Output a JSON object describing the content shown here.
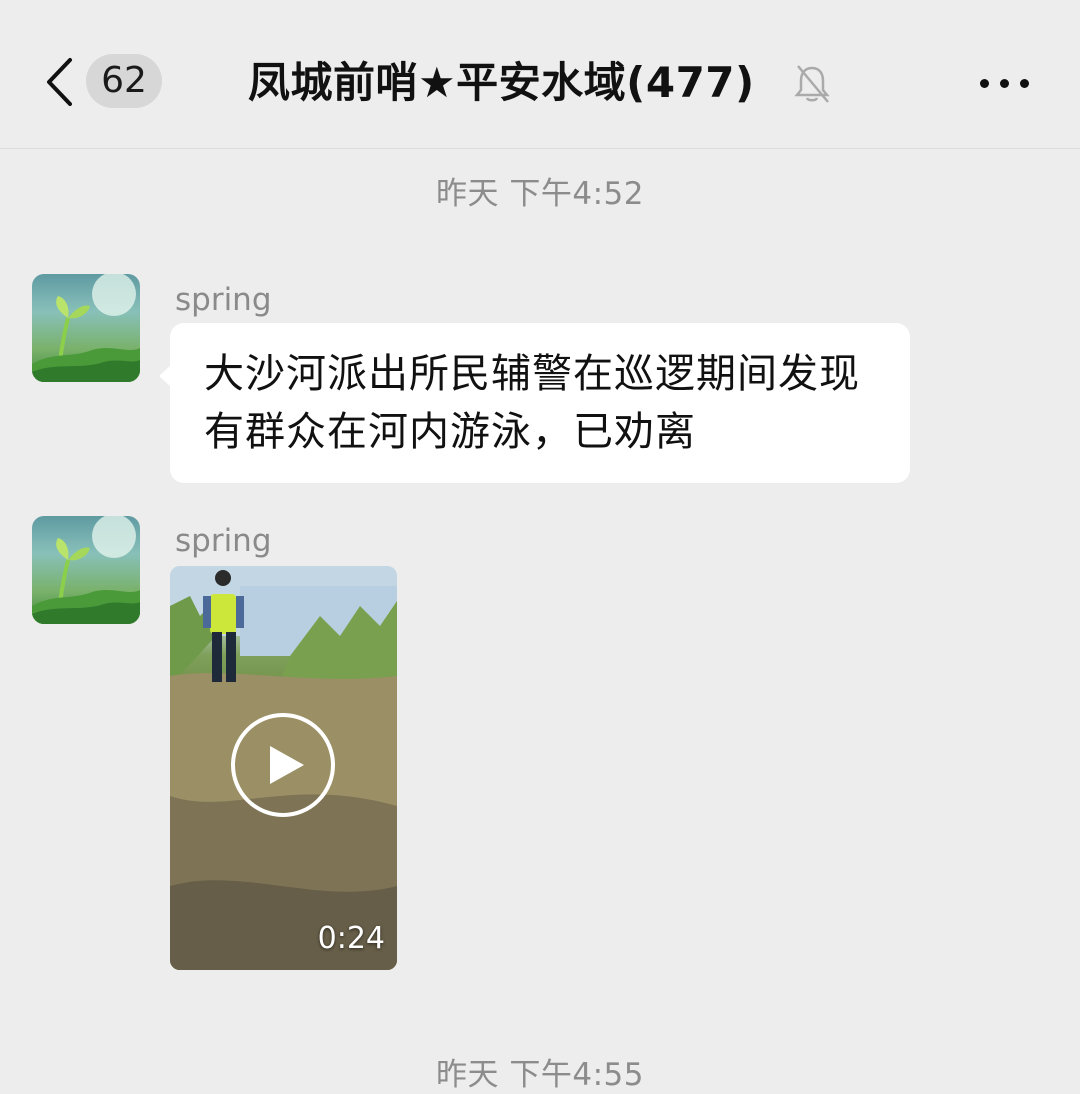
{
  "header": {
    "unread_count": "62",
    "title": "凤城前哨★平安水域(477)",
    "icons": {
      "back": "chevron-left-icon",
      "mute": "bell-off-icon",
      "more": "more-dots-icon"
    }
  },
  "messages": [
    {
      "time": "昨天 下午4:52"
    },
    {
      "sender": "spring",
      "type": "text",
      "text": "大沙河派出所民辅警在巡逻期间发现有群众在河内游泳，已劝离"
    },
    {
      "sender": "spring",
      "type": "video",
      "duration": "0:24"
    },
    {
      "time": "昨天 下午4:55"
    }
  ],
  "colors": {
    "background": "#ededed",
    "bubble": "#ffffff",
    "badge": "#d7d7d7"
  }
}
